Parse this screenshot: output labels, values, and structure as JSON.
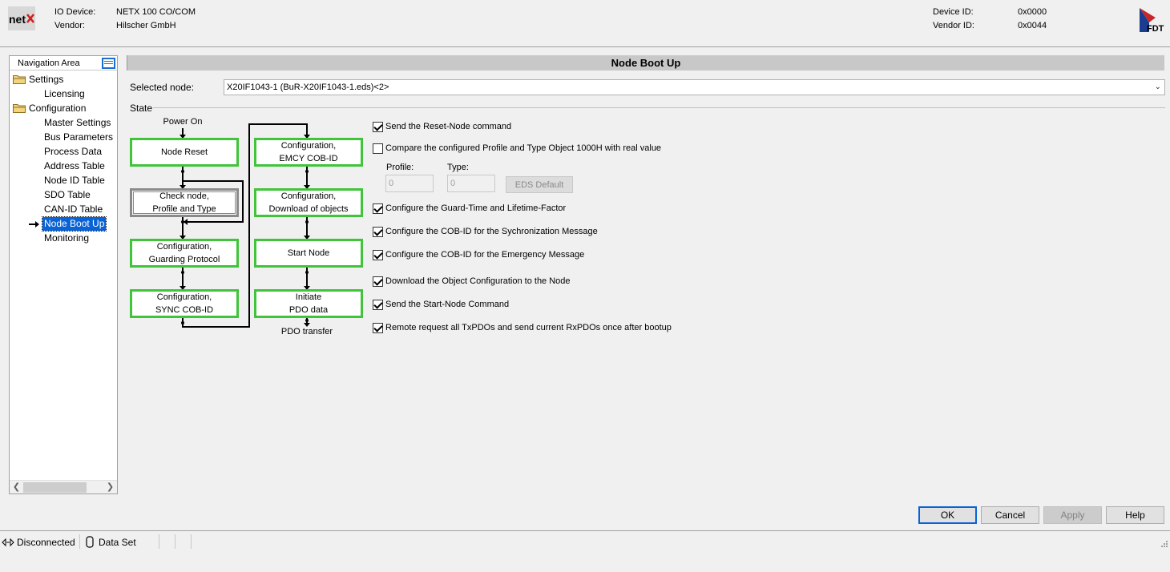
{
  "header": {
    "device_label": "IO Device:",
    "device_value": "NETX 100 CO/COM",
    "vendor_label": "Vendor:",
    "vendor_value": "Hilscher GmbH",
    "device_id_label": "Device ID:",
    "device_id_value": "0x0000",
    "vendor_id_label": "Vendor ID:",
    "vendor_id_value": "0x0044",
    "logo_left": "netx",
    "logo_right": "FDT"
  },
  "nav": {
    "title": "Navigation Area",
    "items": [
      {
        "label": "Settings",
        "type": "folder"
      },
      {
        "label": "Licensing",
        "type": "leaf"
      },
      {
        "label": "Configuration",
        "type": "folder"
      },
      {
        "label": "Master Settings",
        "type": "leaf"
      },
      {
        "label": "Bus Parameters",
        "type": "leaf"
      },
      {
        "label": "Process Data",
        "type": "leaf"
      },
      {
        "label": "Address Table",
        "type": "leaf"
      },
      {
        "label": "Node ID Table",
        "type": "leaf"
      },
      {
        "label": "SDO Table",
        "type": "leaf"
      },
      {
        "label": "CAN-ID Table",
        "type": "leaf"
      },
      {
        "label": "Node Boot Up",
        "type": "leaf",
        "selected": true
      },
      {
        "label": "Monitoring",
        "type": "leaf"
      }
    ]
  },
  "main": {
    "title": "Node Boot Up",
    "selected_node_label": "Selected node:",
    "selected_node_value": "X20IF1043-1 (BuR-X20IF1043-1.eds)<2>",
    "state_label": "State"
  },
  "diagram": {
    "power_on": "Power On",
    "pdo_transfer": "PDO transfer",
    "node_reset": "Node Reset",
    "check_node_1": "Check node,",
    "check_node_2": "Profile and Type",
    "guarding_1": "Configuration,",
    "guarding_2": "Guarding Protocol",
    "sync_1": "Configuration,",
    "sync_2": "SYNC COB-ID",
    "emcy_1": "Configuration,",
    "emcy_2": "EMCY COB-ID",
    "download_1": "Configuration,",
    "download_2": "Download of objects",
    "start_node": "Start Node",
    "initiate_1": "Initiate",
    "initiate_2": "PDO data",
    "active_color": "#3fc43a",
    "inactive_color": "#8a8a8a"
  },
  "options": [
    {
      "label": "Send the Reset-Node command",
      "checked": true
    },
    {
      "label": "Compare the configured Profile and Type Object 1000H with real value",
      "checked": false
    },
    {
      "label": "Configure the Guard-Time and Lifetime-Factor",
      "checked": true
    },
    {
      "label": "Configure the COB-ID for the Sychronization Message",
      "checked": true
    },
    {
      "label": "Configure the COB-ID for the Emergency Message",
      "checked": true
    },
    {
      "label": "Download the Object Configuration to the Node",
      "checked": true
    },
    {
      "label": "Send the Start-Node Command",
      "checked": true
    },
    {
      "label": "Remote request all TxPDOs and send current RxPDOs once after bootup",
      "checked": true
    }
  ],
  "profile": {
    "profile_label": "Profile:",
    "profile_value": "0",
    "type_label": "Type:",
    "type_value": "0",
    "eds_default_label": "EDS Default"
  },
  "buttons": {
    "ok": "OK",
    "cancel": "Cancel",
    "apply": "Apply",
    "help": "Help"
  },
  "status": {
    "connection": "Disconnected",
    "dataset": "Data Set"
  }
}
